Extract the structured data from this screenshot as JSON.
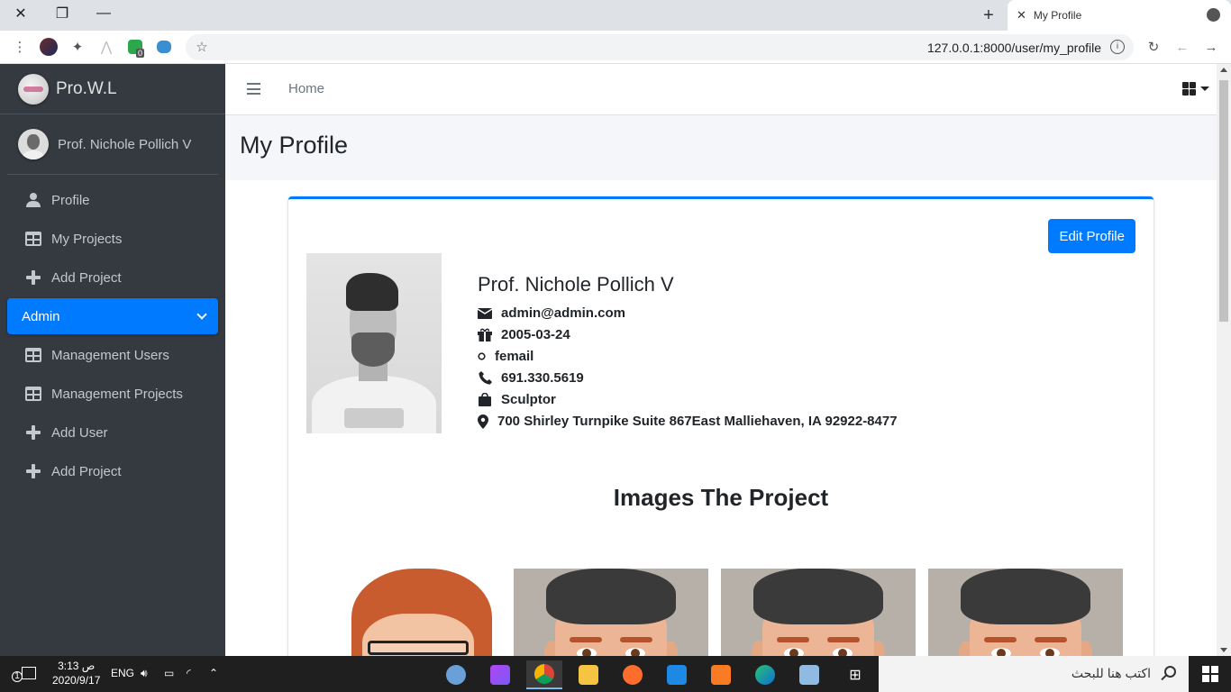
{
  "browser": {
    "tab_title": "My Profile",
    "url": "127.0.0.1:8000/user/my_profile",
    "extension_badge": "0"
  },
  "sidebar": {
    "brand": "Pro.W.L",
    "user_name": "Prof. Nichole Pollich V",
    "items": [
      {
        "label": "Profile",
        "icon": "user-icon"
      },
      {
        "label": "My Projects",
        "icon": "table-icon"
      },
      {
        "label": "Add Project",
        "icon": "plus-icon"
      },
      {
        "label": "Admin",
        "icon": "chevron-down-icon",
        "active": true
      },
      {
        "label": "Management Users",
        "icon": "table-icon"
      },
      {
        "label": "Management Projects",
        "icon": "table-icon"
      },
      {
        "label": "Add User",
        "icon": "plus-icon"
      },
      {
        "label": "Add Project",
        "icon": "plus-icon"
      }
    ]
  },
  "navbar": {
    "home": "Home"
  },
  "page": {
    "title": "My Profile",
    "edit_button": "Edit Profile",
    "profile": {
      "name": "Prof. Nichole Pollich V",
      "email": "admin@admin.com",
      "birthday": "2005-03-24",
      "gender": "femail",
      "phone": "691.330.5619",
      "job": "Sculptor",
      "address": "700 Shirley Turnpike Suite 867East Malliehaven, IA 92922-8477"
    },
    "section_title": "Images The Project"
  },
  "taskbar": {
    "search_placeholder": "اكتب هنا للبحث",
    "time": "3:13 ص",
    "date": "2020/9/17",
    "lang": "ENG",
    "notification_count": "1"
  },
  "colors": {
    "accent": "#007bff",
    "sidebar_bg": "#343a40",
    "taskbar_bg": "#1f1f1f"
  }
}
